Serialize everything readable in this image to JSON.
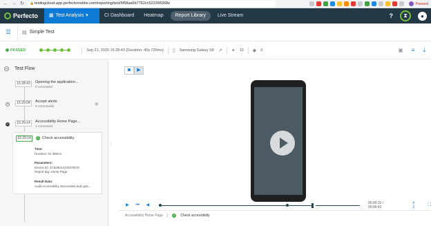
{
  "browser": {
    "url": "testingcloud.app.perfectomobile.com/reporting/test/5f68aa6b7762cc523398368e",
    "paused_label": "Paused"
  },
  "appbar": {
    "brand": "Perfecto",
    "tabs": {
      "test_analysis": "Test Analysis",
      "ci_dashboard": "CI Dashboard",
      "heatmap": "Heatmap",
      "report_library": "Report Library",
      "live_stream": "Live Stream"
    },
    "help": "?",
    "colors": {
      "bar": "#233845",
      "active": "#0d7bd5",
      "accent": "#76c043"
    }
  },
  "crumb": {
    "title": "Simple Test"
  },
  "status": {
    "result": "PASSED",
    "datetime": "Sep 21, 2020 15:28:43 (Duration: 40s 726ms)",
    "device": "Samsung Galaxy S9",
    "count_a": "10",
    "count_b": "3",
    "success_color": "#4caf50"
  },
  "test_flow": {
    "title": "Test Flow",
    "steps": [
      {
        "time": "15:28:43",
        "name": "Opening the application...",
        "sub": "0 command",
        "toggle": ""
      },
      {
        "time": "15:29:08",
        "name": "Accept alerts",
        "sub": "6 commands",
        "toggle": "+"
      },
      {
        "time": "15:29:14",
        "name": "Accessibility Home Page...",
        "sub": "1 command",
        "toggle": "−"
      }
    ],
    "detail": {
      "time": "15:29:14",
      "name": "Check accessibility",
      "time_label": "Time:",
      "duration_label": "Duration:",
      "duration": "0s 355ms",
      "params_label": "Parameters:",
      "device_id_label": "Device ID:",
      "device_id": "2C629D1419237ECE",
      "report_tag_label": "Report tag:",
      "report_tag": "Home Page",
      "result_label": "Result Data:",
      "result_value": "Audit Accessibility Succeeded and uplo..."
    }
  },
  "player": {
    "timer": "00:00:31 / 00:00:41",
    "speed": "x 1",
    "progress": 0.76,
    "caption_parent": "Accessibility Home Page",
    "caption_current": "Check accessibility"
  }
}
